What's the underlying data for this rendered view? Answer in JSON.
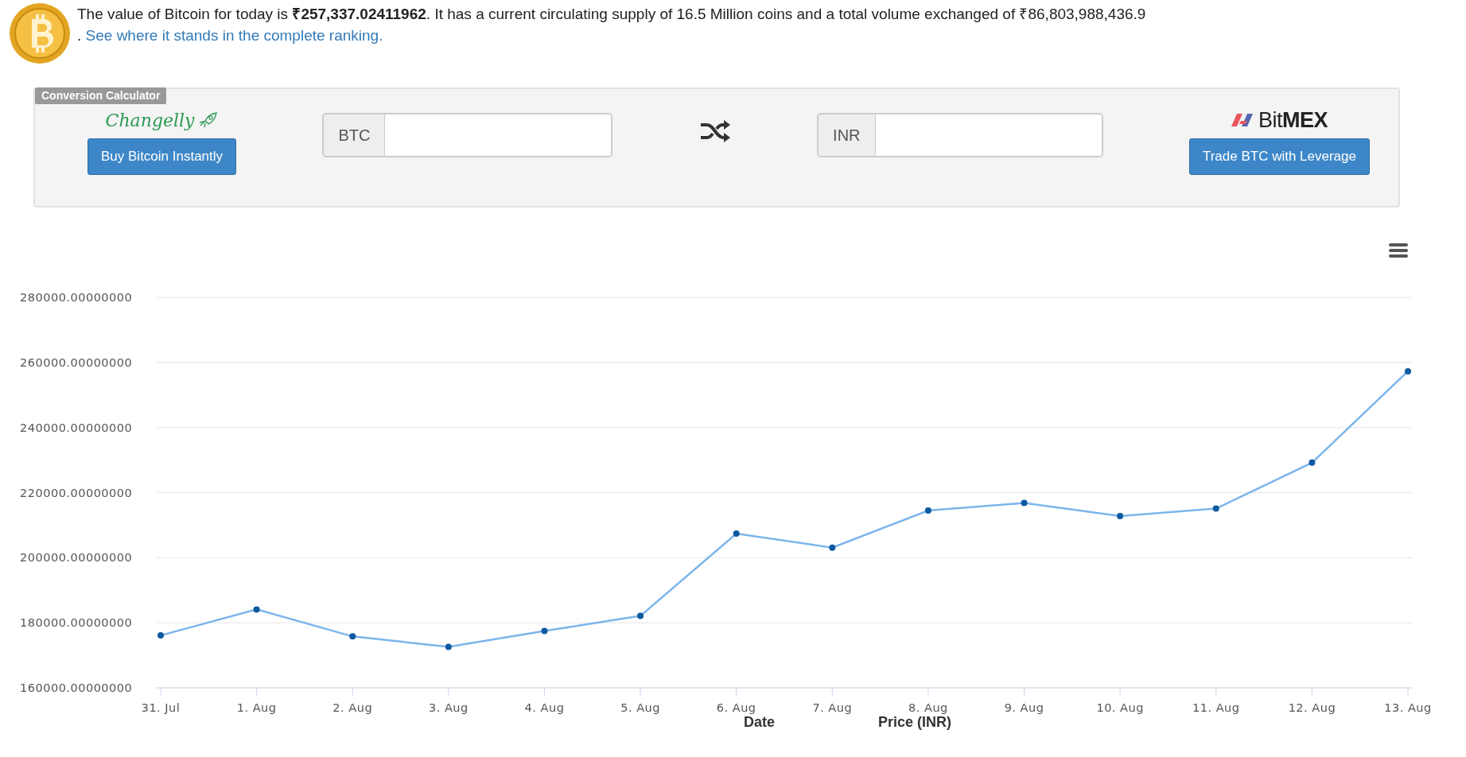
{
  "header": {
    "intro": "The value of Bitcoin for today is **₹257,337.02411962**. It has a current circulating supply of 16.5 Million coins and a total volume exchanged of ₹86,803,988,436.9",
    "link_prefix": ".",
    "link": "See where it stands in the complete ranking."
  },
  "calculator": {
    "title": "Conversion Calculator",
    "left_logo": "Changelly",
    "left_button": "Buy Bitcoin Instantly",
    "from_currency": "BTC",
    "to_currency": "INR",
    "right_logo": "Bit**MEX**",
    "right_button": "Trade BTC with Leverage"
  },
  "chart_data": {
    "type": "line",
    "categories": [
      "31. Jul",
      "1. Aug",
      "2. Aug",
      "3. Aug",
      "4. Aug",
      "5. Aug",
      "6. Aug",
      "7. Aug",
      "8. Aug",
      "9. Aug",
      "10. Aug",
      "11. Aug",
      "12. Aug",
      "13. Aug"
    ],
    "series": [
      {
        "color": "#7cb5ec",
        "marker": true,
        "values": [
          176100,
          184100,
          175800,
          172600,
          177500,
          182100,
          207400,
          203100,
          214500,
          216800,
          212800,
          215100,
          229200,
          257300
        ]
      }
    ],
    "grid": true,
    "ylim": [
      160000,
      280000
    ],
    "yticks": [
      {
        "value": 160000,
        "label": "160000.00000000"
      },
      {
        "value": 180000,
        "label": "180000.00000000"
      },
      {
        "value": 200000,
        "label": "200000.00000000"
      },
      {
        "value": 220000,
        "label": "220000.00000000"
      },
      {
        "value": 240000,
        "label": "240000.00000000"
      },
      {
        "value": 260000,
        "label": "260000.00000000"
      },
      {
        "value": 280000,
        "label": "280000.00000000"
      }
    ]
  },
  "table": {
    "columns": [
      "Date",
      "Price (INR)"
    ]
  }
}
